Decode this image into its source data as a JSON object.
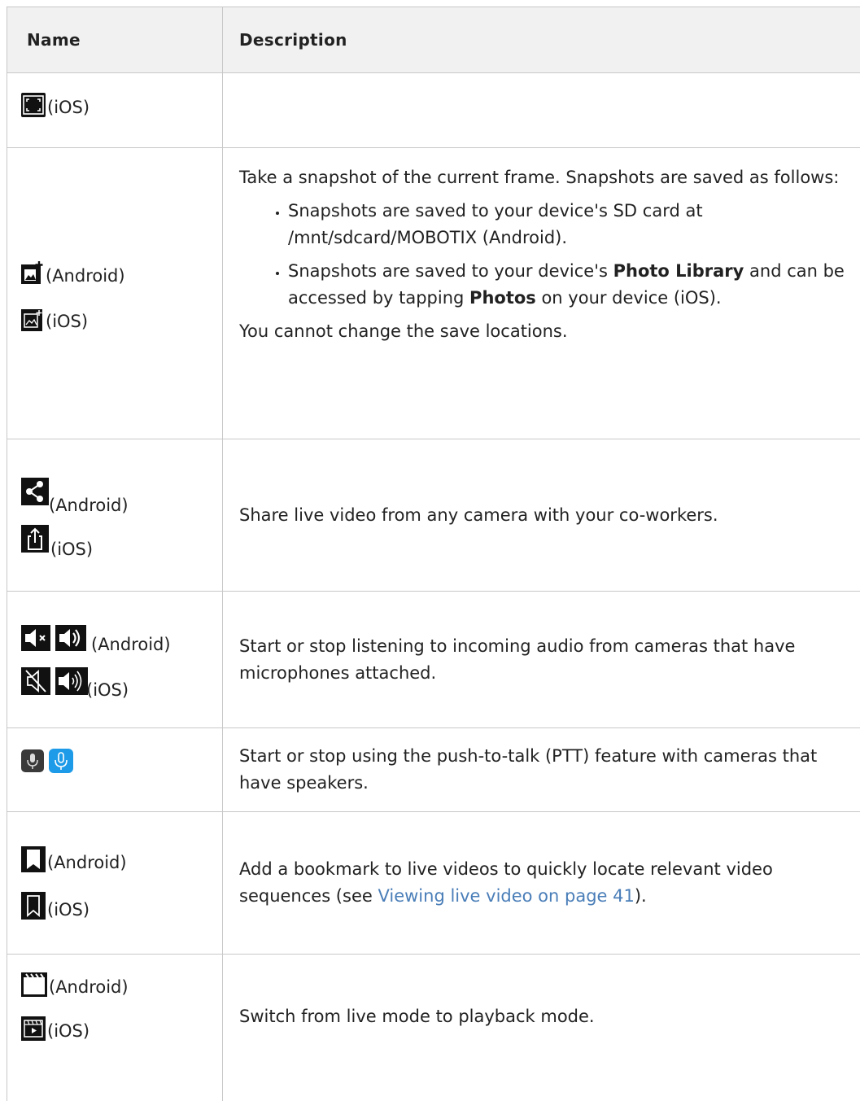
{
  "table": {
    "headers": {
      "name": "Name",
      "description": "Description"
    },
    "rows": [
      {
        "name": [
          {
            "icon": "fullscreen-icon",
            "platform": "(iOS)"
          }
        ],
        "description": ""
      },
      {
        "name": [
          {
            "icon": "add-photo-icon",
            "platform": "(Android)"
          },
          {
            "icon": "add-photo-outline-icon",
            "platform": "(iOS)"
          }
        ],
        "description_intro": "Take a snapshot of the current frame. Snapshots are saved as follows:",
        "bullet1": "Snapshots are saved to your device's SD card at /mnt/sdcard/MOBOTIX (Android).",
        "bullet2_a": "Snapshots are saved to your device's ",
        "bullet2_bold1": "Photo Library",
        "bullet2_b": " and can be accessed by tapping ",
        "bullet2_bold2": "Photos",
        "bullet2_c": " on your device (iOS).",
        "description_outro": "You cannot change the save locations."
      },
      {
        "name": [
          {
            "icon": "share-icon",
            "platform": "(Android)"
          },
          {
            "icon": "share-upload-icon",
            "platform": "(iOS)"
          }
        ],
        "description": "Share live video from any camera with your co-workers."
      },
      {
        "name": [
          {
            "icon": "speaker-mute-and-on-icons",
            "platform": "(Android)"
          },
          {
            "icon": "speaker-off-and-loud-icons",
            "platform": "(iOS)"
          }
        ],
        "description": "Start or stop listening to incoming audio from cameras that have microphones attached."
      },
      {
        "name": [
          {
            "icon": "microphone-icons",
            "platform": ""
          }
        ],
        "description": "Start or stop using the push-to-talk (PTT) feature with cameras that have speakers."
      },
      {
        "name": [
          {
            "icon": "bookmark-filled-icon",
            "platform": "(Android)"
          },
          {
            "icon": "bookmark-outline-icon",
            "platform": "(iOS)"
          }
        ],
        "description_a": "Add a bookmark to live videos to quickly locate relevant video sequences (see ",
        "description_link": "Viewing live video on page 41",
        "description_b": ")."
      },
      {
        "name": [
          {
            "icon": "clapperboard-icon",
            "platform": "(Android)"
          },
          {
            "icon": "playback-icon",
            "platform": "(iOS)"
          }
        ],
        "description": "Switch from live mode to playback mode."
      }
    ]
  },
  "colors": {
    "border": "#c8c8c8",
    "header_bg": "#f1f1f1",
    "link": "#4a7eb8",
    "mic_active": "#1e9be8"
  }
}
